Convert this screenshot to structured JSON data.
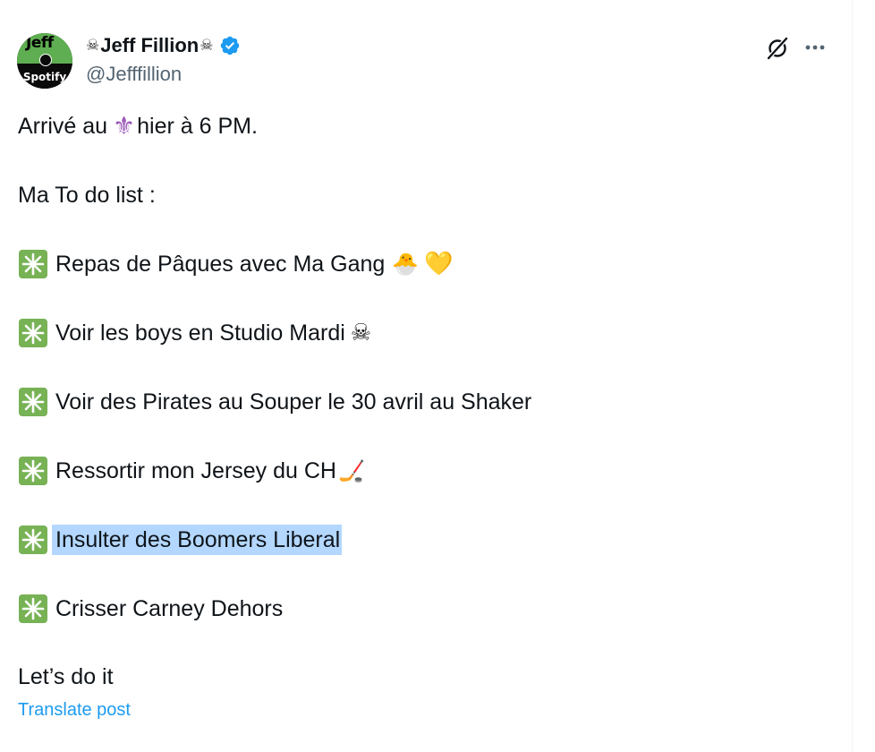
{
  "author": {
    "display_name": "Jeff Fillion",
    "name_emoji_left": "☠",
    "name_emoji_right": "☠",
    "handle": "@Jefffillion",
    "verified": true,
    "avatar": {
      "top_text": "Jeff",
      "bottom_text": "Spotify"
    }
  },
  "header_actions": {
    "grok_icon": "grok-icon",
    "more_icon": "more-horizontal-icon"
  },
  "post": {
    "line1_before": "Arrivé au",
    "line1_emoji": "⚜",
    "line1_after": "hier à 6 PM.",
    "line2": "Ma To do list :",
    "items": [
      {
        "text": "Repas de Pâques avec Ma Gang",
        "emojis": [
          "🐣",
          "💛"
        ]
      },
      {
        "text": "Voir les boys en Studio Mardi",
        "emojis": [
          "☠"
        ]
      },
      {
        "text": "Voir des Pirates au Souper le 30 avril au Shaker",
        "emojis": []
      },
      {
        "text": "Ressortir mon Jersey du CH",
        "emojis": [
          "🏒"
        ]
      },
      {
        "text": "Insulter des Boomers Liberal",
        "emojis": [],
        "selected": true
      },
      {
        "text": "Crisser Carney Dehors",
        "emojis": []
      }
    ],
    "closing": "Let’s do it",
    "bullet_icon": "sparkle-icon"
  },
  "translate_label": "Translate post",
  "colors": {
    "link_blue": "#1d9bf0",
    "verified_blue": "#1d9bf0",
    "sparkle_green": "#77b255",
    "selection": "#b3d7ff",
    "handle_gray": "#536471"
  }
}
